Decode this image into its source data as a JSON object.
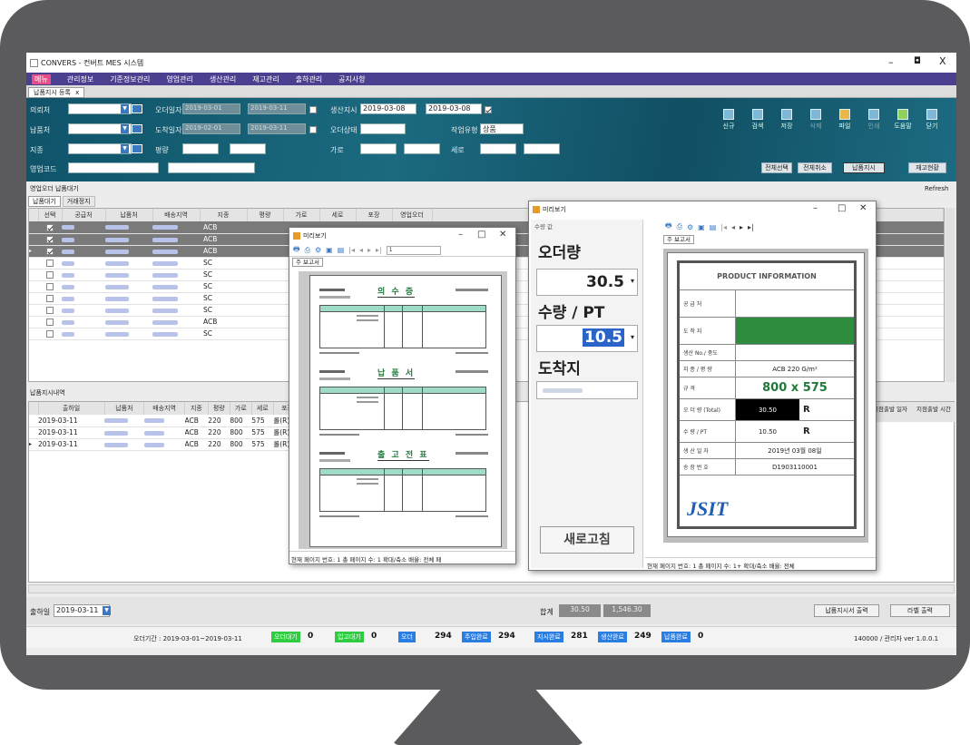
{
  "window": {
    "title": "CONVERS - 컨버트 MES 시스템",
    "controls": {
      "min": "–",
      "max": "◘",
      "close": "X"
    }
  },
  "menu": [
    "메뉴",
    "관리정보",
    "기준정보관리",
    "영업관리",
    "생산관리",
    "재고관리",
    "출하관리",
    "공지사항"
  ],
  "tab": {
    "label": "납품지시 등록",
    "close": "x"
  },
  "filters": {
    "order_place": "의뢰처",
    "delivery_place": "납품처",
    "standard": "지종",
    "sales_code": "영업코드",
    "order_date": "오더일자",
    "order_date_from": "2019-03-01",
    "order_date_to": "2019-03-11",
    "arrival_date": "도착일자",
    "arrival_date_from": "2019-02-01",
    "arrival_date_to": "2019-03-11",
    "ream": "평량",
    "prod_instr": "생산지시",
    "prod_from": "2019-03-08",
    "prod_to": "2019-03-08",
    "order_status": "오더상태",
    "work_type": "작업유형",
    "work_type_value": "상품",
    "width": "가로",
    "height": "세로"
  },
  "toolbar": [
    "신규",
    "검색",
    "저장",
    "삭제",
    "파일",
    "인쇄",
    "도움말",
    "닫기"
  ],
  "action_buttons": [
    "전체선택",
    "전체취소",
    "납품지시",
    "재고현황"
  ],
  "upper_grid": {
    "caption": "영업오더 납품대기",
    "refresh": "Refresh",
    "subtabs": [
      "납품대기",
      "거래정지"
    ],
    "headers": [
      "선택",
      "공급처",
      "납품처",
      "배송지역",
      "지종",
      "평량",
      "가로",
      "세로",
      "포장",
      "영업오더"
    ],
    "rows": [
      {
        "checked": true,
        "grade": "ACB",
        "highlight": true
      },
      {
        "checked": true,
        "grade": "ACB",
        "highlight": true
      },
      {
        "checked": true,
        "grade": "ACB",
        "highlight": true
      },
      {
        "checked": false,
        "grade": "SC"
      },
      {
        "checked": false,
        "grade": "SC"
      },
      {
        "checked": false,
        "grade": "SC"
      },
      {
        "checked": false,
        "grade": "SC"
      },
      {
        "checked": false,
        "grade": "SC"
      },
      {
        "checked": false,
        "grade": "ACB"
      },
      {
        "checked": false,
        "grade": "SC"
      }
    ]
  },
  "lower_grid": {
    "caption": "납품지시내역",
    "headers": [
      "출하일",
      "납품처",
      "배송지역",
      "지종",
      "평량",
      "가로",
      "세로",
      "포장"
    ],
    "right_headers": [
      "지점출발 일자",
      "지점출발 시간"
    ],
    "rows": [
      {
        "date": "2019-03-11",
        "grade": "ACB",
        "weight": "220",
        "w": "800",
        "h": "575",
        "pack": "롤(R)"
      },
      {
        "date": "2019-03-11",
        "grade": "ACB",
        "weight": "220",
        "w": "800",
        "h": "575",
        "pack": "롤(R)"
      },
      {
        "date": "2019-03-11",
        "grade": "ACB",
        "weight": "220",
        "w": "800",
        "h": "575",
        "pack": "롤(R)"
      }
    ]
  },
  "preview_small": {
    "title": "미리보기",
    "subtab": "주 보고서",
    "page_field": "1",
    "docs": [
      {
        "heading": "의 수 증"
      },
      {
        "heading": "납 품 서"
      },
      {
        "heading": "출 고 전 표"
      }
    ],
    "status": "현재 페이지 번호: 1    총 페이지 수: 1    확대/축소 배율: 전체 페"
  },
  "preview_large": {
    "title": "미리보기",
    "left_caption": "수량 값",
    "order_qty_label": "오더량",
    "order_qty_value": "30.5",
    "qty_pt_label": "수량 / PT",
    "qty_pt_value": "10.5",
    "dest_label": "도착지",
    "refresh_btn": "새로고침",
    "subtab": "주 보고서",
    "card": {
      "title": "PRODUCT INFORMATION",
      "rows": [
        {
          "label": "공 급 처",
          "value": ""
        },
        {
          "label": "도 착 지",
          "value": ""
        },
        {
          "label": "생산 No./ 중도",
          "value": ""
        },
        {
          "label": "지 종 / 평 량",
          "value": "ACB 220 G/m²"
        },
        {
          "label": "규 격",
          "value": "800  x  575"
        },
        {
          "label": "오 더 량 (Total)",
          "value": "30.50",
          "unit": "R"
        },
        {
          "label": "수 량 / PT",
          "value": "10.50",
          "unit": "R"
        },
        {
          "label": "생 산 일 자",
          "value": "2019년 03월 08일"
        },
        {
          "label": "송 장 번 호",
          "value": "D1903110001"
        }
      ],
      "logo": "JSIT"
    },
    "status": "현재 페이지 번호: 1    총 페이지 수: 1+    확대/축소 배율: 전체"
  },
  "bottom": {
    "ship_label": "출하일",
    "ship_date": "2019-03-11",
    "total_label": "합계",
    "total1": "30.50",
    "total2": "1,546.30",
    "btn_print_instr": "납품지시서 출력",
    "btn_label_print": "라벨 출력"
  },
  "status_bar": {
    "period": "오더기간 : 2019-03-01~2019-03-11",
    "counters": [
      {
        "label": "오더대기",
        "value": "0",
        "color": "#2ecc40"
      },
      {
        "label": "입고대기",
        "value": "0",
        "color": "#2ecc40"
      },
      {
        "label": "오더",
        "value": "294",
        "color": "#2a7de1"
      },
      {
        "label": "주입완료",
        "value": "294",
        "color": "#2a7de1"
      },
      {
        "label": "지시완료",
        "value": "281",
        "color": "#2a7de1"
      },
      {
        "label": "생산완료",
        "value": "249",
        "color": "#2a7de1"
      },
      {
        "label": "납품완료",
        "value": "0",
        "color": "#2a7de1"
      }
    ],
    "right": "140000 / 관리자 ver 1.0.0.1"
  }
}
